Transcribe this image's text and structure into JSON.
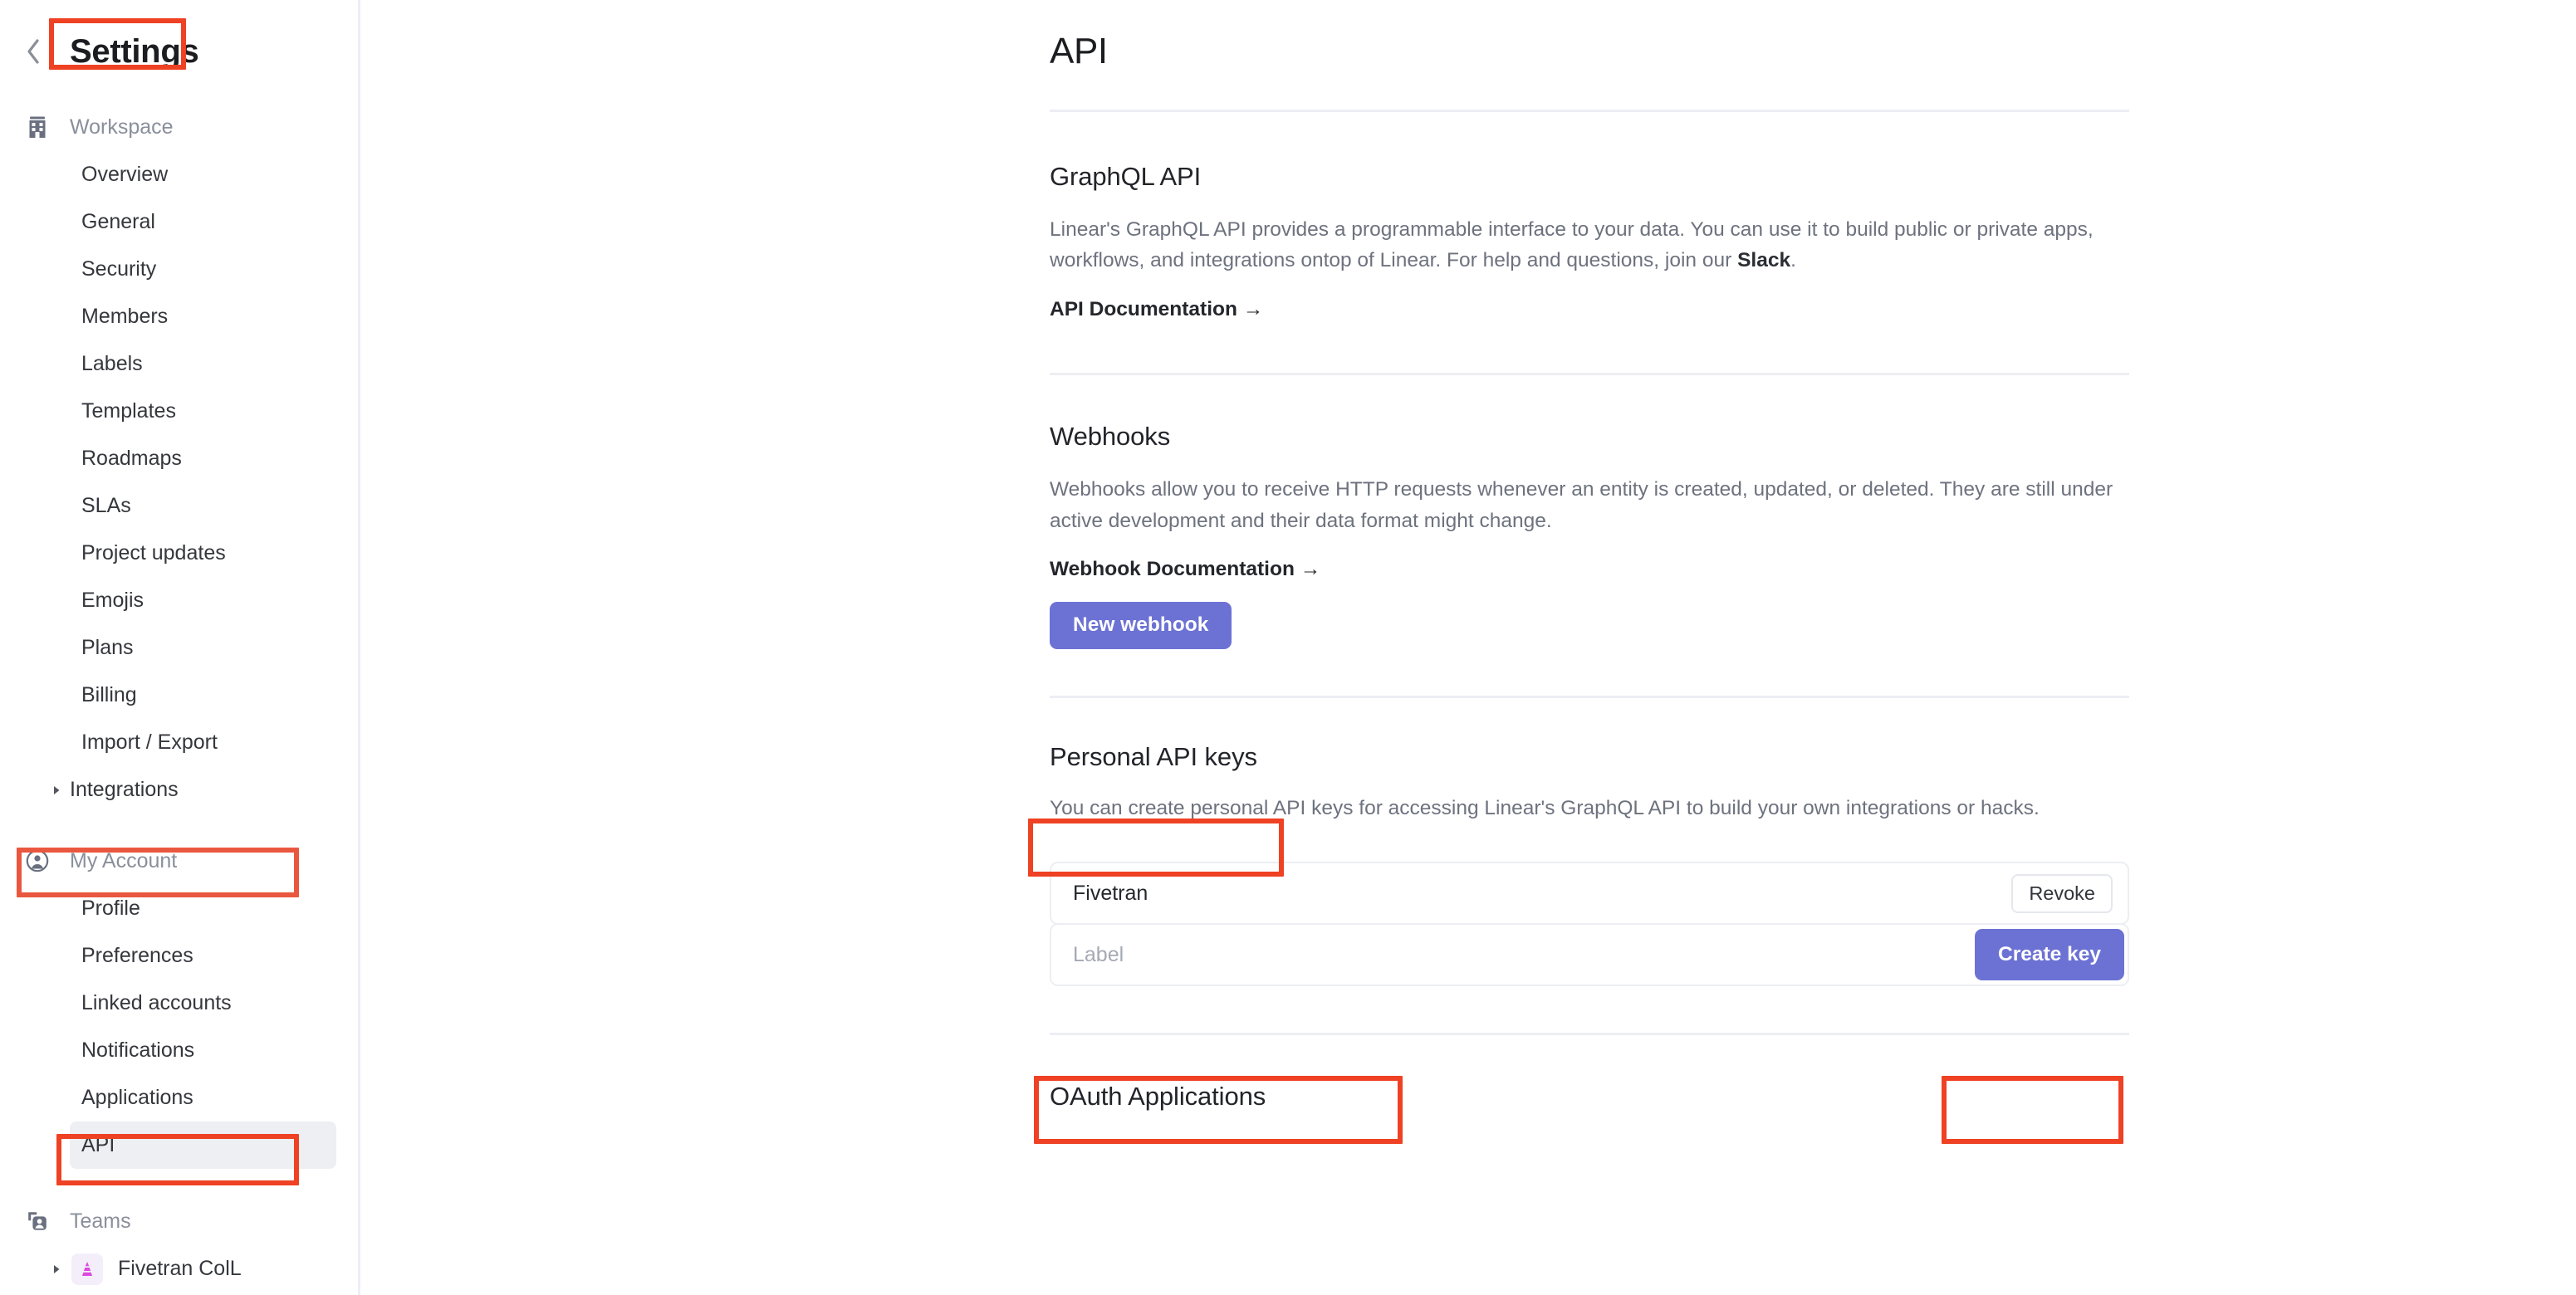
{
  "sidebar": {
    "back_icon": "chevron-left-icon",
    "title": "Settings",
    "groups": [
      {
        "id": "workspace",
        "icon": "building-icon",
        "label": "Workspace",
        "items": [
          {
            "label": "Overview",
            "selected": false,
            "caret": false
          },
          {
            "label": "General",
            "selected": false,
            "caret": false
          },
          {
            "label": "Security",
            "selected": false,
            "caret": false
          },
          {
            "label": "Members",
            "selected": false,
            "caret": false
          },
          {
            "label": "Labels",
            "selected": false,
            "caret": false
          },
          {
            "label": "Templates",
            "selected": false,
            "caret": false
          },
          {
            "label": "Roadmaps",
            "selected": false,
            "caret": false
          },
          {
            "label": "SLAs",
            "selected": false,
            "caret": false
          },
          {
            "label": "Project updates",
            "selected": false,
            "caret": false
          },
          {
            "label": "Emojis",
            "selected": false,
            "caret": false
          },
          {
            "label": "Plans",
            "selected": false,
            "caret": false
          },
          {
            "label": "Billing",
            "selected": false,
            "caret": false
          },
          {
            "label": "Import / Export",
            "selected": false,
            "caret": false
          },
          {
            "label": "Integrations",
            "selected": false,
            "caret": true
          }
        ]
      },
      {
        "id": "my-account",
        "icon": "user-circle-icon",
        "label": "My Account",
        "items": [
          {
            "label": "Profile",
            "selected": false,
            "caret": false
          },
          {
            "label": "Preferences",
            "selected": false,
            "caret": false
          },
          {
            "label": "Linked accounts",
            "selected": false,
            "caret": false
          },
          {
            "label": "Notifications",
            "selected": false,
            "caret": false
          },
          {
            "label": "Applications",
            "selected": false,
            "caret": false
          },
          {
            "label": "API",
            "selected": true,
            "caret": false
          }
        ]
      },
      {
        "id": "teams",
        "icon": "teams-icon",
        "label": "Teams",
        "items": [
          {
            "label": "Fivetran ColL",
            "selected": false,
            "caret": true,
            "avatar": "traffic-cone-icon"
          }
        ]
      }
    ]
  },
  "main": {
    "page_title": "API",
    "sections": [
      {
        "id": "graphql-api",
        "title": "GraphQL API",
        "body_before": "Linear's GraphQL API provides a programmable interface to your data. You can use it to build public or private apps, workflows, and integrations ontop of Linear. For help and questions, join our ",
        "body_link": "Slack",
        "body_after": ".",
        "doc_link": "API Documentation →"
      },
      {
        "id": "webhooks",
        "title": "Webhooks",
        "body": "Webhooks allow you to receive HTTP requests whenever an entity is created, updated, or deleted. They are still under active development and their data format might change.",
        "doc_link": "Webhook Documentation →",
        "button": "New webhook"
      },
      {
        "id": "personal-api-keys",
        "title": "Personal API keys",
        "body": "You can create personal API keys for accessing Linear's GraphQL API to build your own integrations or hacks.",
        "keys": [
          {
            "name": "Fivetran",
            "action": "Revoke"
          }
        ],
        "label_placeholder": "Label",
        "label_value": "",
        "create_button": "Create key"
      },
      {
        "id": "oauth-applications",
        "title": "OAuth Applications"
      }
    ]
  },
  "colors": {
    "accent_purple": "#6c72d4",
    "annotation_red": "#ef4123",
    "annotation_red_soft": "#e9573f",
    "selected_item_bg": "#edeff3",
    "divider": "#eceef4"
  }
}
